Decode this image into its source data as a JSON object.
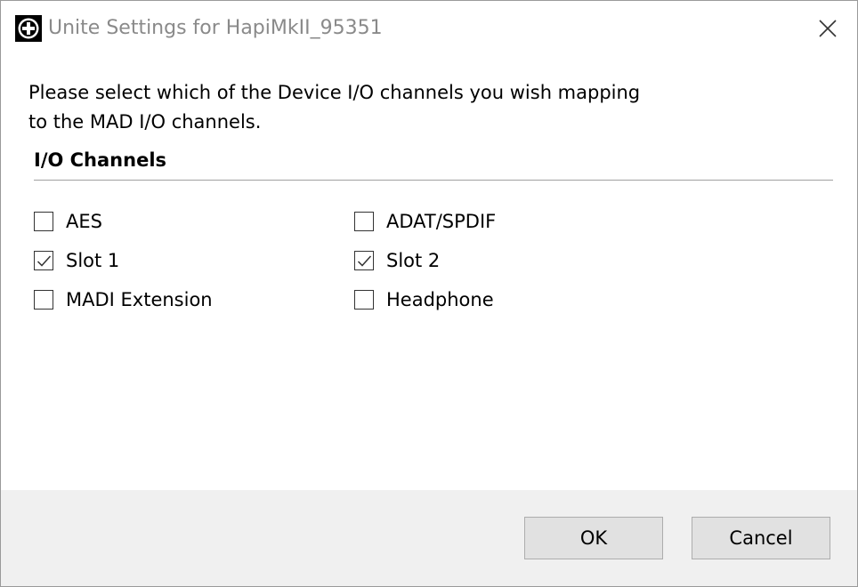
{
  "window": {
    "title": "Unite Settings for HapiMkII_95351",
    "app_icon": "plus-circle-icon",
    "close_icon": "close-icon"
  },
  "content": {
    "instruction_line1": "Please select which of the Device I/O channels you wish mapping",
    "instruction_line2": "to the MAD I/O channels.",
    "group_title": "I/O Channels",
    "channels": [
      {
        "label": "AES",
        "checked": false
      },
      {
        "label": "ADAT/SPDIF",
        "checked": false
      },
      {
        "label": "Slot 1",
        "checked": true
      },
      {
        "label": "Slot 2",
        "checked": true
      },
      {
        "label": "MADI Extension",
        "checked": false
      },
      {
        "label": "Headphone",
        "checked": false
      }
    ]
  },
  "buttons": {
    "ok": "OK",
    "cancel": "Cancel"
  },
  "colors": {
    "footer_bg": "#f0f0f0",
    "button_bg": "#e1e1e1",
    "title_text": "#8a8a8a"
  }
}
